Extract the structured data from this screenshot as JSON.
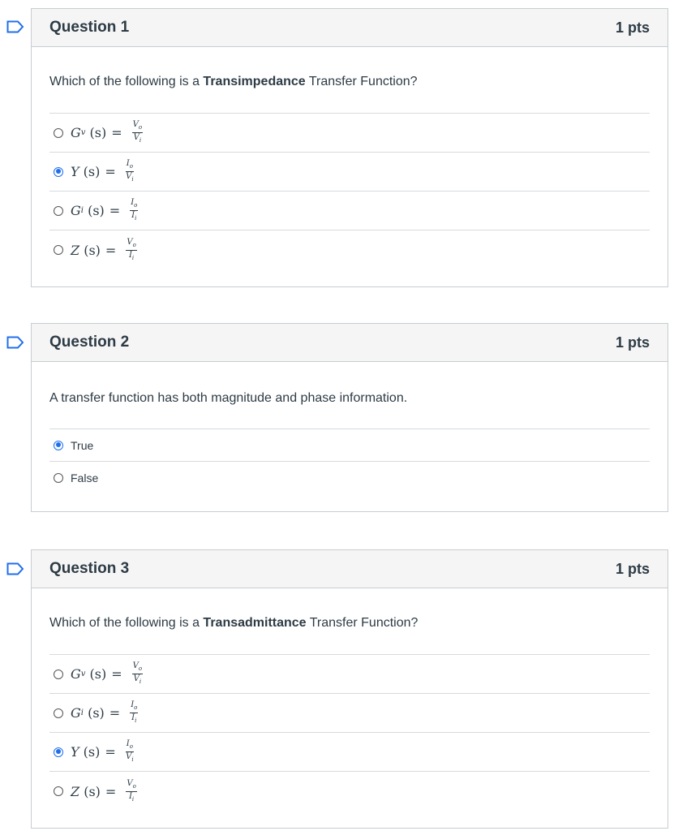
{
  "questions": [
    {
      "title": "Question 1",
      "points": "1 pts",
      "text_before": "Which of the following is a ",
      "text_bold": "Transimpedance",
      "text_after": " Transfer Function?",
      "answers": [
        {
          "lhs": "G",
          "sub": "v",
          "arg": "(s)",
          "num": "Vo",
          "den": "Vi",
          "selected": false
        },
        {
          "lhs": "Y",
          "sub": "",
          "arg": "(s)",
          "num": "Io",
          "den": "Vi",
          "selected": true
        },
        {
          "lhs": "G",
          "sub": "i",
          "arg": "(s)",
          "num": "Io",
          "den": "Ii",
          "selected": false
        },
        {
          "lhs": "Z",
          "sub": "",
          "arg": "(s)",
          "num": "Vo",
          "den": "Ii",
          "selected": false
        }
      ]
    },
    {
      "title": "Question 2",
      "points": "1 pts",
      "text": "A transfer function has both magnitude and phase information.",
      "answers": [
        {
          "label": "True",
          "selected": true
        },
        {
          "label": "False",
          "selected": false
        }
      ]
    },
    {
      "title": "Question 3",
      "points": "1 pts",
      "text_before": "Which of the following is a ",
      "text_bold": "Transadmittance",
      "text_after": " Transfer Function?",
      "answers": [
        {
          "lhs": "G",
          "sub": "v",
          "arg": "(s)",
          "num": "Vo",
          "den": "Vi",
          "selected": false
        },
        {
          "lhs": "G",
          "sub": "i",
          "arg": "(s)",
          "num": "Io",
          "den": "Ii",
          "selected": false
        },
        {
          "lhs": "Y",
          "sub": "",
          "arg": "(s)",
          "num": "Io",
          "den": "Vi",
          "selected": true
        },
        {
          "lhs": "Z",
          "sub": "",
          "arg": "(s)",
          "num": "Vo",
          "den": "Ii",
          "selected": false
        }
      ]
    }
  ],
  "equals_sign": "=",
  "colors": {
    "accent": "#1f6feb",
    "flag": "#1f6feb",
    "header_bg": "#f5f5f5",
    "border": "#c7cdd1"
  },
  "icons": {
    "flag": "bookmark-flag-icon"
  }
}
